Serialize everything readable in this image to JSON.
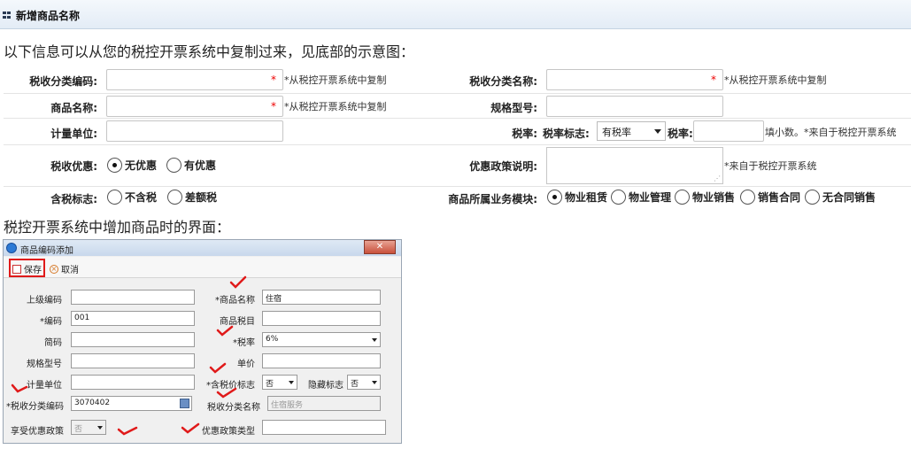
{
  "panel": {
    "title": "新增商品名称"
  },
  "intro": "以下信息可以从您的税控开票系统中复制过来，见底部的示意图：",
  "form": {
    "tax_code_label": "税收分类编码:",
    "tax_code_hint": "*从税控开票系统中复制",
    "tax_name_label": "税收分类名称:",
    "tax_name_hint": "*从税控开票系统中复制",
    "product_name_label": "商品名称:",
    "product_name_hint": "*从税控开票系统中复制",
    "spec_label": "规格型号:",
    "unit_label": "计量单位:",
    "rate_label": "税率:",
    "rate_flag_label": "税率标志:",
    "rate_flag_value": "有税率",
    "rate_value_label": "税率:",
    "rate_hint": "填小数。*来自于税控开票系统",
    "preferential_label": "税收优惠:",
    "preferential_options": [
      "无优惠",
      "有优惠"
    ],
    "policy_label": "优惠政策说明:",
    "policy_hint": "*来自于税控开票系统",
    "tax_incl_label": "含税标志:",
    "tax_incl_options": [
      "不含税",
      "差额税"
    ],
    "module_label": "商品所属业务模块:",
    "module_options": [
      "物业租赁",
      "物业管理",
      "物业销售",
      "销售合同",
      "无合同销售"
    ],
    "required_mark": "*"
  },
  "intro2": "税控开票系统中增加商品时的界面：",
  "screenshot": {
    "window_title": "商品编码添加",
    "close_glyph": "✕",
    "save": "保存",
    "cancel": "取消",
    "labels": {
      "parent_code": "上级编码",
      "code": "*编码",
      "short_code": "简码",
      "spec": "规格型号",
      "unit": "计量单位",
      "tax_class_code": "*税收分类编码",
      "enjoy_pref": "享受优惠政策",
      "product_name": "*商品名称",
      "product_tax": "商品税目",
      "rate": "*税率",
      "price": "单价",
      "tax_incl": "*含税价标志",
      "hide": "隐藏标志",
      "tax_class_name": "税收分类名称",
      "pref_type": "优惠政策类型"
    },
    "values": {
      "code": "001",
      "product_name": "住宿",
      "rate": "6%",
      "tax_incl": "否",
      "hide": "否",
      "tax_class_code": "3070402",
      "tax_class_name": "住宿服务",
      "enjoy_pref": "否"
    }
  },
  "colors": {
    "accent_red": "#e01a1a",
    "title_bg": "#e3ecf6"
  }
}
